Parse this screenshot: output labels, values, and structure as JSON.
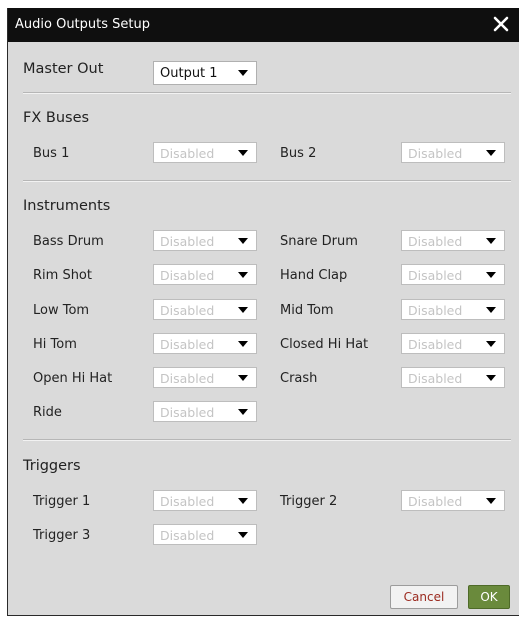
{
  "dialog": {
    "title": "Audio Outputs Setup",
    "close_icon": "close-icon"
  },
  "master": {
    "label": "Master Out",
    "value": "Output 1"
  },
  "fx_buses": {
    "heading": "FX Buses",
    "bus1": {
      "label": "Bus 1",
      "value": "Disabled"
    },
    "bus2": {
      "label": "Bus 2",
      "value": "Disabled"
    }
  },
  "instruments": {
    "heading": "Instruments",
    "bass_drum": {
      "label": "Bass Drum",
      "value": "Disabled"
    },
    "snare_drum": {
      "label": "Snare Drum",
      "value": "Disabled"
    },
    "rim_shot": {
      "label": "Rim Shot",
      "value": "Disabled"
    },
    "hand_clap": {
      "label": "Hand Clap",
      "value": "Disabled"
    },
    "low_tom": {
      "label": "Low Tom",
      "value": "Disabled"
    },
    "mid_tom": {
      "label": "Mid Tom",
      "value": "Disabled"
    },
    "hi_tom": {
      "label": "Hi Tom",
      "value": "Disabled"
    },
    "closed_hi_hat": {
      "label": "Closed Hi Hat",
      "value": "Disabled"
    },
    "open_hi_hat": {
      "label": "Open Hi Hat",
      "value": "Disabled"
    },
    "crash": {
      "label": "Crash",
      "value": "Disabled"
    },
    "ride": {
      "label": "Ride",
      "value": "Disabled"
    }
  },
  "triggers": {
    "heading": "Triggers",
    "trigger1": {
      "label": "Trigger 1",
      "value": "Disabled"
    },
    "trigger2": {
      "label": "Trigger 2",
      "value": "Disabled"
    },
    "trigger3": {
      "label": "Trigger 3",
      "value": "Disabled"
    }
  },
  "buttons": {
    "cancel": "Cancel",
    "ok": "OK"
  },
  "colors": {
    "titlebar": "#0f0f0f",
    "panel": "#dadada",
    "ok_button": "#6a8a3c",
    "cancel_text": "#9b2a1f",
    "disabled_text": "#c4c4c4"
  }
}
